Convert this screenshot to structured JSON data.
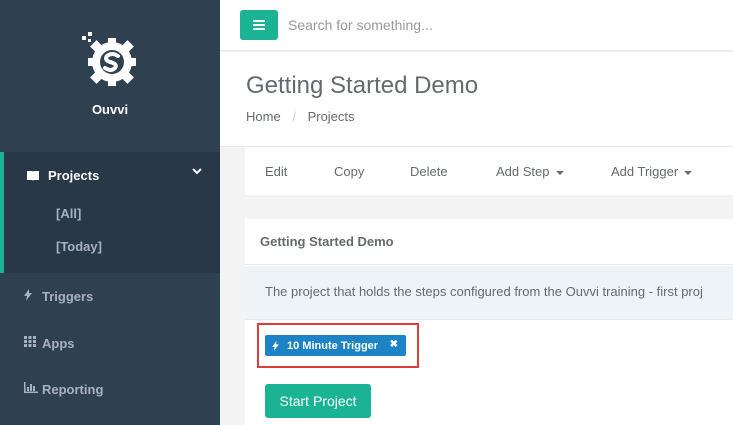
{
  "brand": {
    "name": "Ouvvi"
  },
  "sidebar": {
    "projects": {
      "label": "Projects",
      "sub": [
        "[All]",
        "[Today]"
      ]
    },
    "items": [
      {
        "label": "Triggers",
        "icon": "bolt-icon"
      },
      {
        "label": "Apps",
        "icon": "grid-icon"
      },
      {
        "label": "Reporting",
        "icon": "bar-chart-icon"
      }
    ]
  },
  "header": {
    "search_placeholder": "Search for something..."
  },
  "page": {
    "title": "Getting Started Demo",
    "breadcrumb": [
      "Home",
      "Projects"
    ]
  },
  "toolbar": {
    "edit": "Edit",
    "copy": "Copy",
    "delete": "Delete",
    "add_step": "Add Step",
    "add_trigger": "Add Trigger"
  },
  "panel": {
    "title": "Getting Started Demo",
    "description": "The project that holds the steps configured from the Ouvvi training - first proj",
    "tag": "10 Minute Trigger",
    "start_button": "Start Project"
  },
  "colors": {
    "sidebar": "#2f4050",
    "accent": "#1ab394",
    "tag": "#1c84c6",
    "highlight": "#e03c3c"
  }
}
